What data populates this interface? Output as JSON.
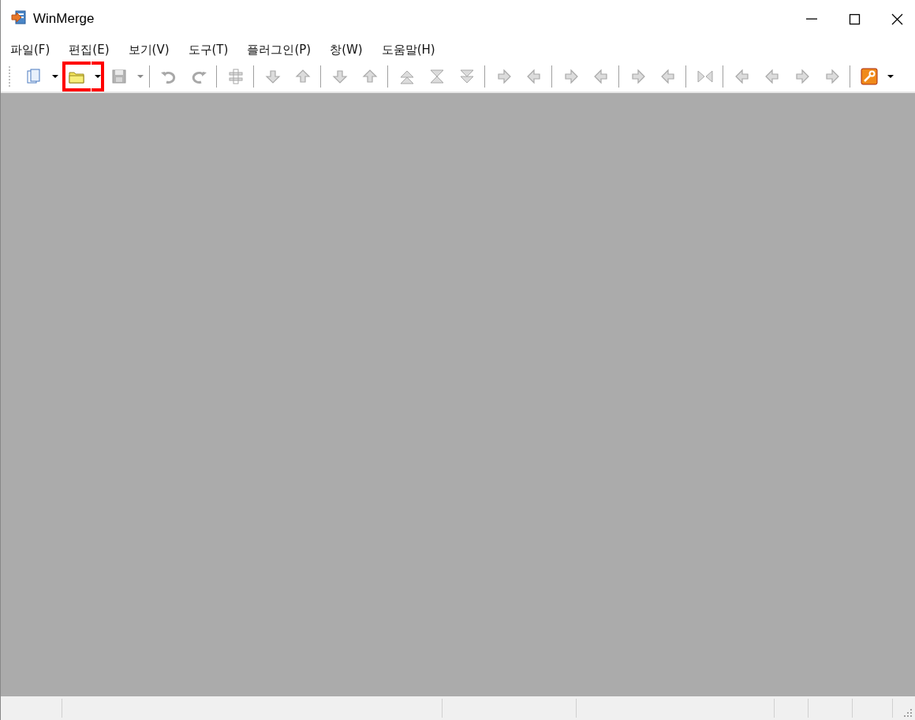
{
  "window": {
    "title": "WinMerge"
  },
  "menu": [
    {
      "label": "파일(F)"
    },
    {
      "label": "편집(E)"
    },
    {
      "label": "보기(V)"
    },
    {
      "label": "도구(T)"
    },
    {
      "label": "플러그인(P)"
    },
    {
      "label": "창(W)"
    },
    {
      "label": "도움말(H)"
    }
  ],
  "toolbar": [
    {
      "kind": "button",
      "disabled": false,
      "highlighted": false
    },
    {
      "kind": "dropdown",
      "disabled": false,
      "highlighted": false
    },
    {
      "kind": "button",
      "disabled": false,
      "highlighted": true
    },
    {
      "kind": "dropdown",
      "disabled": false,
      "highlighted": true
    },
    {
      "kind": "button",
      "disabled": true,
      "highlighted": false
    },
    {
      "kind": "dropdown",
      "disabled": true,
      "highlighted": false
    },
    {
      "kind": "separator"
    },
    {
      "kind": "button",
      "disabled": true,
      "highlighted": false
    },
    {
      "kind": "button",
      "disabled": true,
      "highlighted": false
    },
    {
      "kind": "separator"
    },
    {
      "kind": "button",
      "disabled": true,
      "highlighted": false
    },
    {
      "kind": "separator"
    },
    {
      "kind": "button",
      "disabled": true,
      "highlighted": false
    },
    {
      "kind": "button",
      "disabled": true,
      "highlighted": false
    },
    {
      "kind": "separator"
    },
    {
      "kind": "button",
      "disabled": true,
      "highlighted": false
    },
    {
      "kind": "button",
      "disabled": true,
      "highlighted": false
    },
    {
      "kind": "separator"
    },
    {
      "kind": "button",
      "disabled": true,
      "highlighted": false
    },
    {
      "kind": "button",
      "disabled": true,
      "highlighted": false
    },
    {
      "kind": "button",
      "disabled": true,
      "highlighted": false
    },
    {
      "kind": "separator"
    },
    {
      "kind": "button",
      "disabled": true,
      "highlighted": false
    },
    {
      "kind": "button",
      "disabled": true,
      "highlighted": false
    },
    {
      "kind": "separator"
    },
    {
      "kind": "button",
      "disabled": true,
      "highlighted": false
    },
    {
      "kind": "button",
      "disabled": true,
      "highlighted": false
    },
    {
      "kind": "separator"
    },
    {
      "kind": "button",
      "disabled": true,
      "highlighted": false
    },
    {
      "kind": "button",
      "disabled": true,
      "highlighted": false
    },
    {
      "kind": "separator"
    },
    {
      "kind": "button",
      "disabled": true,
      "highlighted": false
    },
    {
      "kind": "separator"
    },
    {
      "kind": "button",
      "disabled": true,
      "highlighted": false
    },
    {
      "kind": "button",
      "disabled": true,
      "highlighted": false
    },
    {
      "kind": "button",
      "disabled": true,
      "highlighted": false
    },
    {
      "kind": "button",
      "disabled": true,
      "highlighted": false
    },
    {
      "kind": "separator"
    },
    {
      "kind": "button",
      "disabled": false,
      "highlighted": false
    },
    {
      "kind": "dropdown",
      "disabled": false,
      "highlighted": false
    }
  ]
}
